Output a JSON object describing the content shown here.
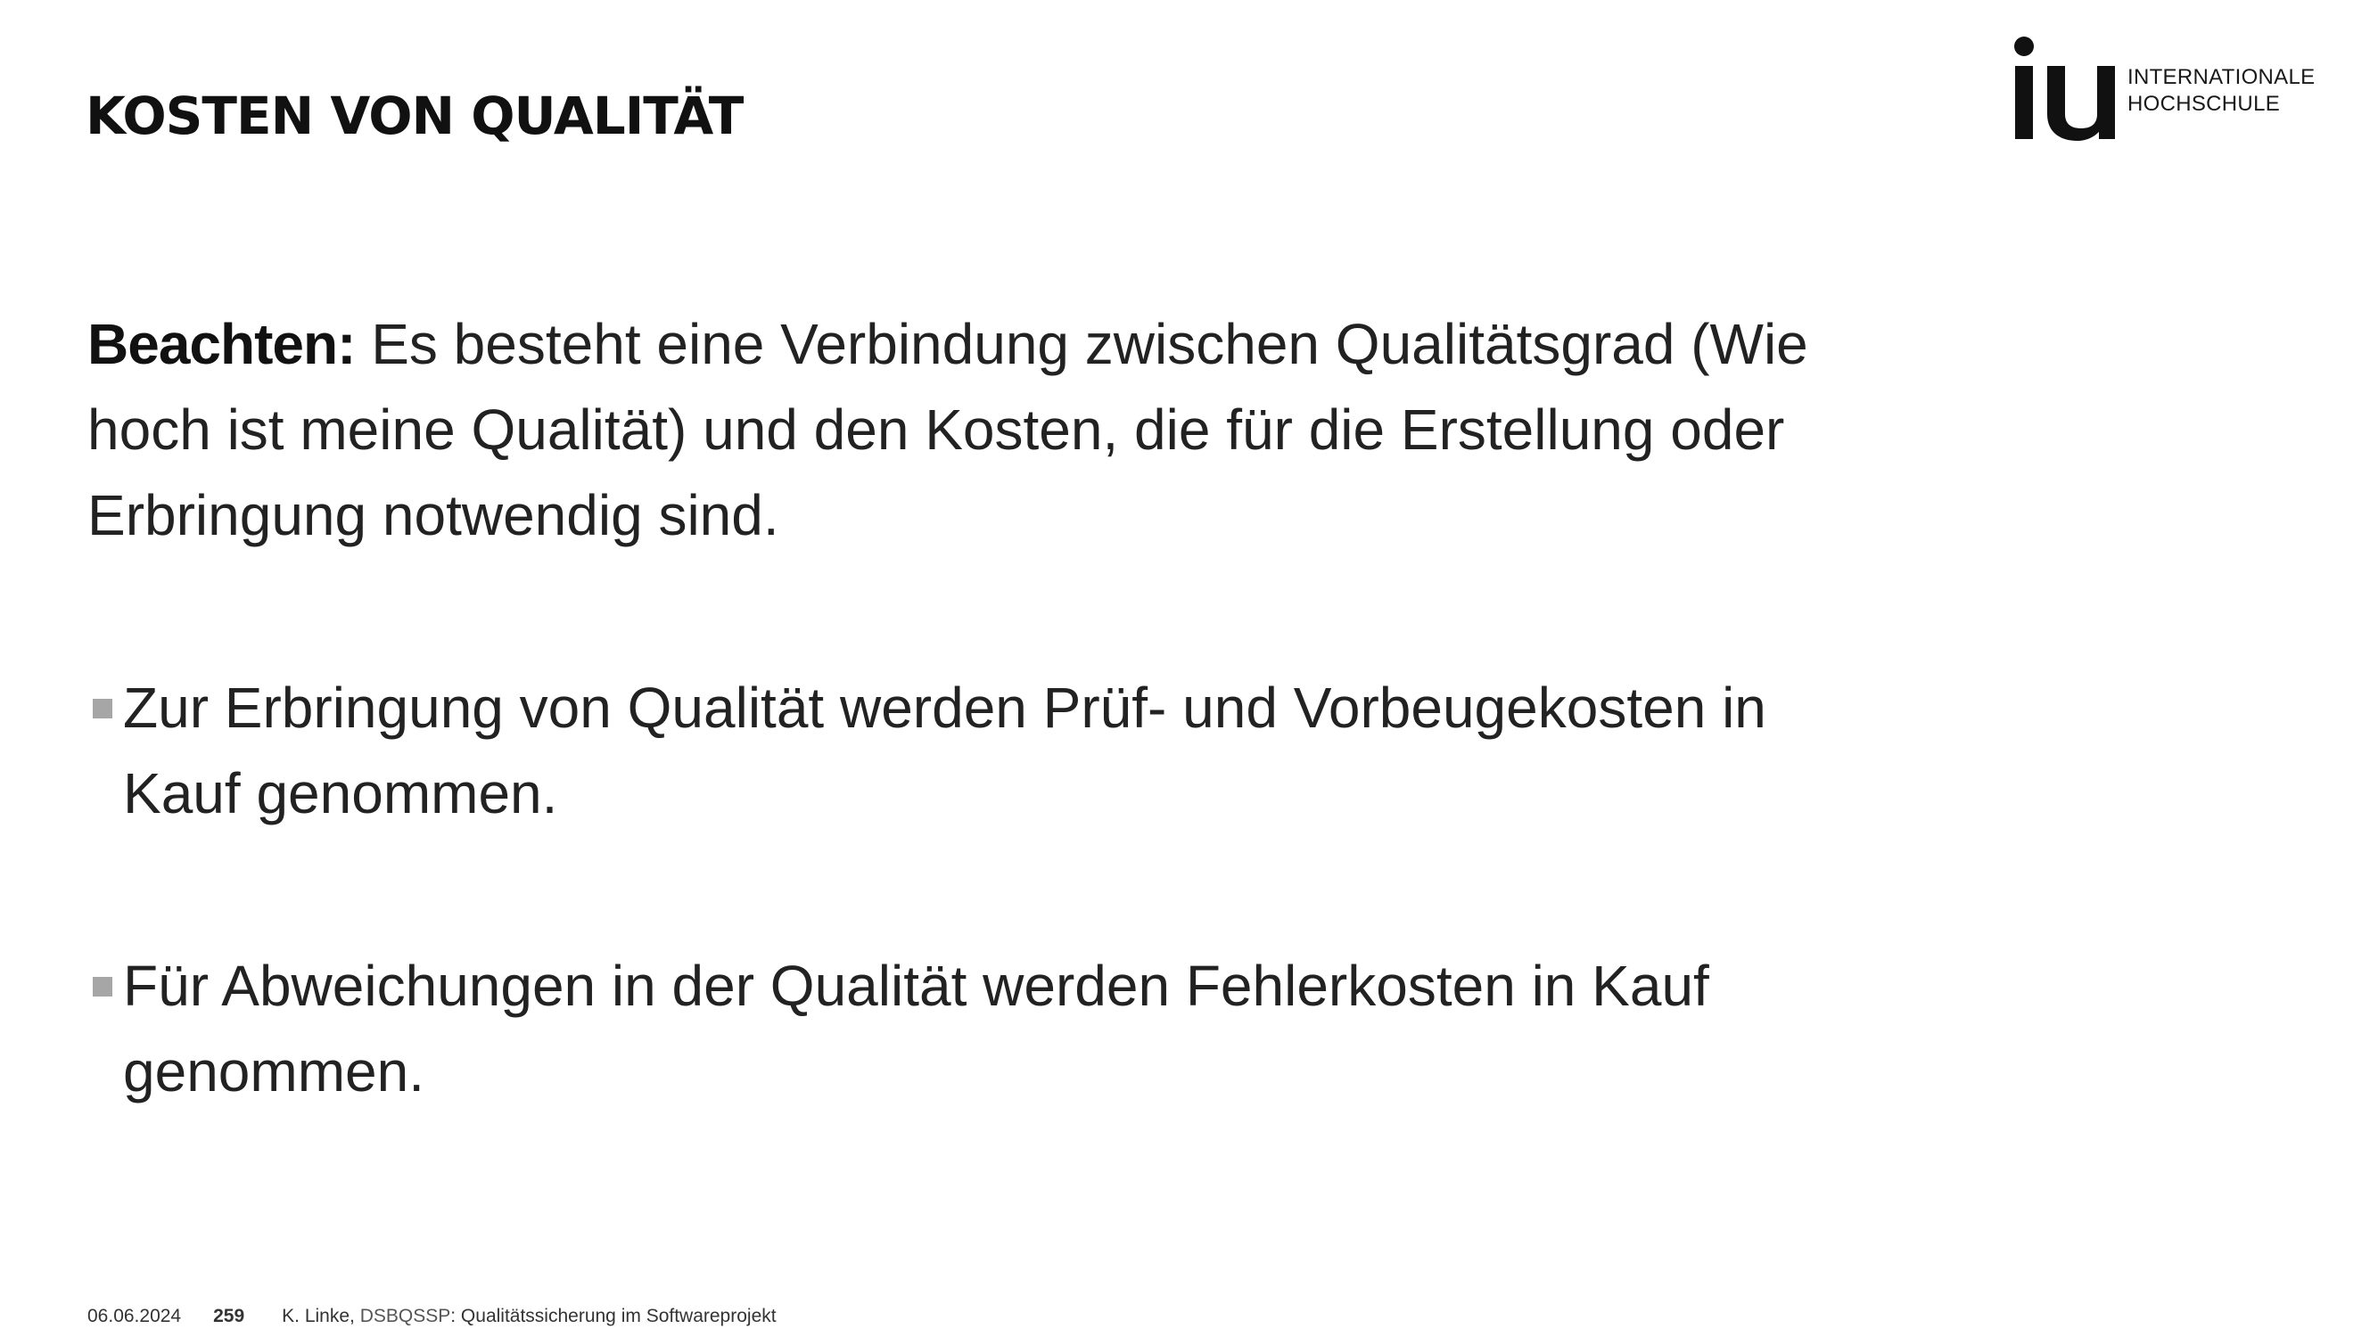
{
  "slide": {
    "title": "KOSTEN VON QUALITÄT"
  },
  "logo": {
    "mark": "iu",
    "line1": "INTERNATIONALE",
    "line2": "HOCHSCHULE"
  },
  "content": {
    "lead": "Beachten:",
    "intro": " Es besteht eine Verbindung zwischen Qualitätsgrad (Wie hoch ist meine Qualität) und den Kosten, die für die Erstellung oder Erbringung notwendig sind.",
    "bullets": [
      "Zur Erbringung von Qualität werden Prüf- und Vorbeugekosten in Kauf genommen.",
      "Für Abweichungen in der Qualität werden Fehlerkosten in Kauf genommen."
    ]
  },
  "footer": {
    "date": "06.06.2024",
    "page": "259",
    "author": "K. Linke, ",
    "course_code": "DSBQSSP",
    "course_title": ": Qualitätssicherung im Softwareprojekt"
  },
  "colors": {
    "text": "#222222",
    "bullet_marker": "#a6a6a6",
    "background": "#ffffff"
  }
}
